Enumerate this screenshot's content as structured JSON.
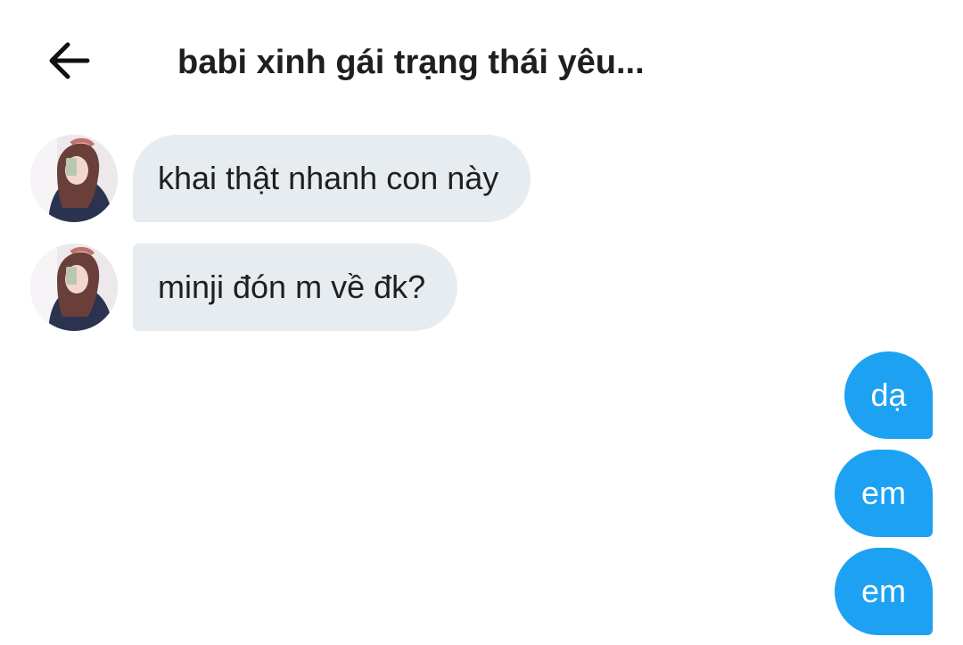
{
  "header": {
    "back_icon": "arrow-left-icon",
    "title": "babi xinh gái trạng thái yêu..."
  },
  "colors": {
    "incoming_bubble": "#e6ecf0",
    "outgoing_bubble": "#1da1f2",
    "text_dark": "#1f1f1f"
  },
  "messages": {
    "incoming": [
      {
        "text": "khai thật nhanh con này"
      },
      {
        "text": "minji đón m về đk?"
      }
    ],
    "outgoing": [
      {
        "text": "dạ"
      },
      {
        "text": "em"
      },
      {
        "text": "em"
      }
    ]
  }
}
